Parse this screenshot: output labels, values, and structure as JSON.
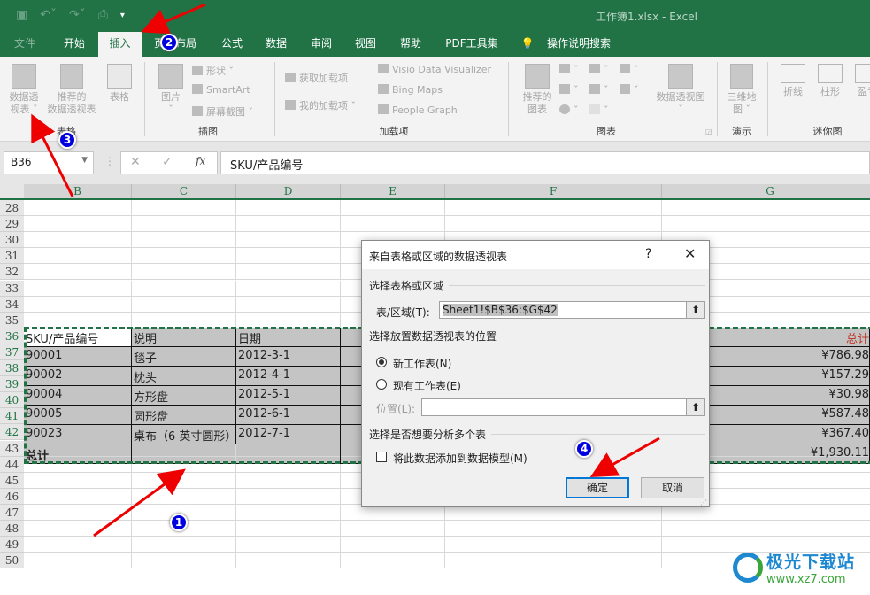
{
  "window": {
    "title": "工作簿1.xlsx  -  Excel"
  },
  "qat": {
    "icons": [
      "save-icon",
      "undo-icon",
      "redo-icon",
      "print-preview-icon",
      "customize-qat-icon"
    ]
  },
  "tabs": [
    {
      "label": "文件"
    },
    {
      "label": "开始"
    },
    {
      "label": "插入",
      "active": true
    },
    {
      "label": "页面布局"
    },
    {
      "label": "公式"
    },
    {
      "label": "数据"
    },
    {
      "label": "审阅"
    },
    {
      "label": "视图"
    },
    {
      "label": "帮助"
    },
    {
      "label": "PDF工具集"
    },
    {
      "label": "操作说明搜索"
    }
  ],
  "ribbon": {
    "groups": [
      {
        "name": "表格",
        "buttons": [
          "数据透视表",
          "推荐的数据透视表",
          "表格"
        ]
      },
      {
        "name": "插图",
        "buttons": [
          "图片",
          "形状",
          "SmartArt",
          "屏幕截图"
        ]
      },
      {
        "name": "加载项",
        "buttons": [
          "获取加载项",
          "我的加载项",
          "Visio Data Visualizer",
          "Bing Maps",
          "People Graph"
        ]
      },
      {
        "name": "图表",
        "buttons": [
          "推荐的图表",
          "数据透视图"
        ]
      },
      {
        "name": "演示",
        "buttons": [
          "三维地图"
        ]
      },
      {
        "name": "迷你图",
        "buttons": [
          "折线",
          "柱形",
          "盈亏"
        ]
      }
    ],
    "labels": {
      "pivot_line1": "数据透",
      "pivot_line2": "视表 ˇ",
      "rec_pivot_line1": "推荐的",
      "rec_pivot_line2": "数据透视表",
      "table": "表格",
      "picture": "图片",
      "shapes": "形状 ˇ",
      "smartart": "SmartArt",
      "screenshot": "屏幕截图 ˇ",
      "get_addins": "获取加载项",
      "my_addins": "我的加载项",
      "visio": "Visio Data Visualizer",
      "bing": "Bing Maps",
      "people": "People Graph",
      "rec_chart_line1": "推荐的",
      "rec_chart_line2": "图表",
      "pivot_chart": "数据透视图",
      "map3d_line1": "三维地",
      "map3d_line2": "图 ˇ",
      "spark_line": "折线",
      "spark_col": "柱形",
      "spark_wl": "盈亏"
    }
  },
  "formula_bar": {
    "name_box": "B36",
    "fx": "fx",
    "content": "SKU/产品编号"
  },
  "columns": [
    "B",
    "C",
    "D",
    "E",
    "F",
    "G"
  ],
  "rows": [
    "28",
    "29",
    "30",
    "31",
    "32",
    "33",
    "34",
    "35",
    "36",
    "37",
    "38",
    "39",
    "40",
    "41",
    "42",
    "43",
    "44",
    "45",
    "46",
    "47",
    "48",
    "49",
    "50"
  ],
  "table": {
    "headers": {
      "sku": "SKU/产品编号",
      "desc": "说明",
      "date": "日期",
      "total": "总计"
    },
    "rows": [
      {
        "sku": "90001",
        "desc": "毯子",
        "date": "2012-3-1",
        "total": "¥786.98"
      },
      {
        "sku": "90002",
        "desc": "枕头",
        "date": "2012-4-1",
        "total": "¥157.29"
      },
      {
        "sku": "90004",
        "desc": "方形盘",
        "date": "2012-5-1",
        "total": "¥30.98"
      },
      {
        "sku": "90005",
        "desc": "圆形盘",
        "date": "2012-6-1",
        "total": "¥587.48"
      },
      {
        "sku": "90023",
        "desc": "桌布（6 英寸圆形）",
        "date": "2012-7-1",
        "total": "¥367.40"
      }
    ],
    "footer": {
      "label": "总计",
      "total": "¥1,930.11"
    }
  },
  "dialog": {
    "title": "来自表格或区域的数据透视表",
    "help": "?",
    "close": "✕",
    "section1": "选择表格或区域",
    "range_label": "表/区域(T):",
    "range_value": "Sheet1!$B$36:$G$42",
    "section2": "选择放置数据透视表的位置",
    "opt_new": "新工作表(N)",
    "opt_existing": "现有工作表(E)",
    "location_label": "位置(L):",
    "location_value": "",
    "section3": "选择是否想要分析多个表",
    "add_model": "将此数据添加到数据模型(M)",
    "ok": "确定",
    "cancel": "取消",
    "selected_option": "new",
    "add_model_checked": false
  },
  "annotations": {
    "b1": "1",
    "b2": "2",
    "b3": "3",
    "b4": "4"
  },
  "watermark": {
    "name": "极光下载站",
    "url": "www.xz7.com"
  }
}
